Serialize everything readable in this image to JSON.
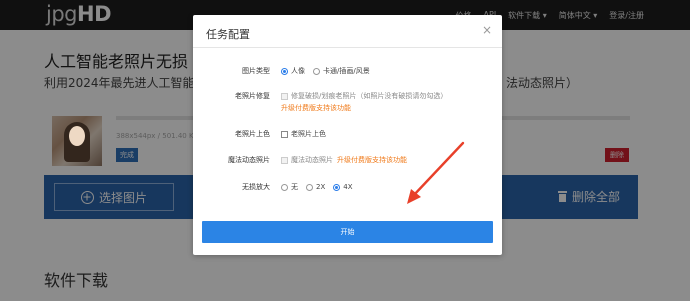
{
  "header": {
    "logo_thin": "jpg",
    "logo_bold": "HD",
    "nav": [
      "价格",
      "API",
      "软件下载 ▾",
      "简体中文 ▾",
      "登录/注册"
    ]
  },
  "page": {
    "title": "人工智能老照片无损",
    "subtitle_left": "利用2024年最先进人工智能 A",
    "subtitle_right": "法动态照片）",
    "file_info": "388x544px / 501.40 Kb",
    "done_button": "完成",
    "delete_button": "删除",
    "choose_button": "选择图片",
    "delete_all": "删除全部",
    "section_title": "软件下载"
  },
  "modal": {
    "title": "任务配置",
    "close": "×",
    "image_type": {
      "label": "图片类型",
      "options": [
        "人像",
        "卡通/插画/风景"
      ],
      "selected": "人像"
    },
    "repair": {
      "label": "老照片修复",
      "option": "修复破损/划痕老照片（如照片没有破损请勿勾选）",
      "note": "升级付费版支持该功能"
    },
    "colorize": {
      "label": "老照片上色",
      "option": "老照片上色"
    },
    "magic": {
      "label": "魔法动态照片",
      "option": "魔法动态照片",
      "note": "升级付费版支持该功能"
    },
    "upscale": {
      "label": "无损放大",
      "options": [
        "无",
        "2X",
        "4X"
      ],
      "selected": "4X"
    },
    "start_button": "开始"
  },
  "colors": {
    "accent": "#2b84e5",
    "note": "#f07a1a",
    "arrow": "#e8402a",
    "bar": "#2b64ac"
  }
}
